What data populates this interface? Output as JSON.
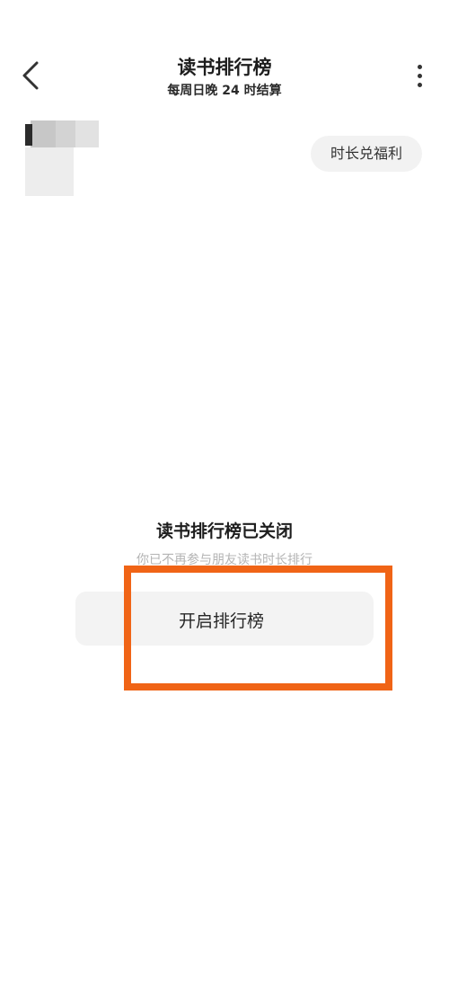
{
  "header": {
    "title": "读书排行榜",
    "subtitle": "每周日晚 24 时结算"
  },
  "icons": {
    "back": "chevron-left-icon",
    "more": "more-vertical-icon"
  },
  "welfare_button": {
    "label": "时长兑福利"
  },
  "status": {
    "title": "读书排行榜已关闭",
    "description": "你已不再参与朋友读书时长排行"
  },
  "open_button": {
    "label": "开启排行榜"
  },
  "colors": {
    "highlight": "#f06416",
    "button_bg": "#f3f3f3",
    "muted_text": "#b4b4b4"
  }
}
